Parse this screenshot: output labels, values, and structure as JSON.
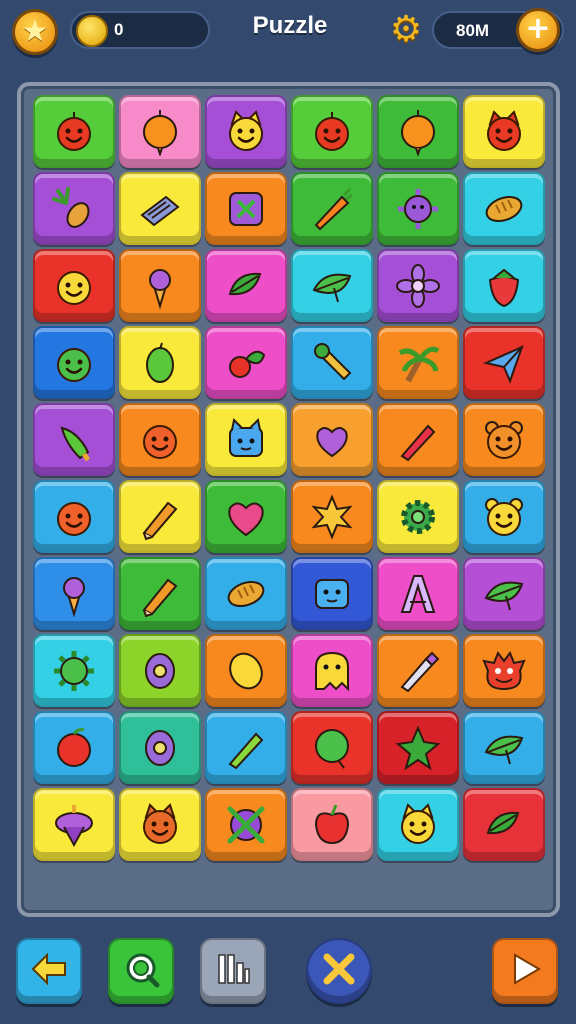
{
  "header": {
    "title": "Puzzle",
    "coins": "0",
    "cash": "80M"
  },
  "board": {
    "rows": [
      [
        {
          "color": "#55cc3a",
          "icon": "red-fruit-face-icon"
        },
        {
          "color": "#f78ac8",
          "icon": "orange-fruit-icon"
        },
        {
          "color": "#a44fd6",
          "icon": "yellow-cat-face-icon"
        },
        {
          "color": "#55cc3a",
          "icon": "red-fruit-face-icon"
        },
        {
          "color": "#3fbb3a",
          "icon": "orange-fruit-icon"
        },
        {
          "color": "#f9e93a",
          "icon": "red-devil-face-icon"
        }
      ],
      [
        {
          "color": "#a44fd6",
          "icon": "pineapple-icon"
        },
        {
          "color": "#f9e93a",
          "icon": "book-icon"
        },
        {
          "color": "#f7891f",
          "icon": "purple-box-icon"
        },
        {
          "color": "#3fbb3a",
          "icon": "carrot-icon"
        },
        {
          "color": "#3fbb3a",
          "icon": "purple-virus-icon"
        },
        {
          "color": "#33d0e6",
          "icon": "bread-icon"
        }
      ],
      [
        {
          "color": "#e8322a",
          "icon": "yellow-smiley-icon"
        },
        {
          "color": "#f7891f",
          "icon": "ice-cream-icon"
        },
        {
          "color": "#ee4fc9",
          "icon": "green-leaves-icon"
        },
        {
          "color": "#33d0e6",
          "icon": "green-leaf-icon"
        },
        {
          "color": "#a44fd6",
          "icon": "purple-flower-icon"
        },
        {
          "color": "#33d0e6",
          "icon": "strawberry-icon"
        }
      ],
      [
        {
          "color": "#2477e0",
          "icon": "green-blob-face-icon"
        },
        {
          "color": "#f9e93a",
          "icon": "green-mango-icon"
        },
        {
          "color": "#ee4fc9",
          "icon": "cherry-leaf-icon"
        },
        {
          "color": "#33aee8",
          "icon": "wrench-icon"
        },
        {
          "color": "#f7891f",
          "icon": "palm-tree-icon"
        },
        {
          "color": "#e8322a",
          "icon": "paper-plane-icon"
        }
      ],
      [
        {
          "color": "#a44fd6",
          "icon": "green-pepper-icon"
        },
        {
          "color": "#f7891f",
          "icon": "orange-face-icon"
        },
        {
          "color": "#f9e93a",
          "icon": "blue-cat-face-icon"
        },
        {
          "color": "#f7a030",
          "icon": "purple-heart-icon"
        },
        {
          "color": "#f7891f",
          "icon": "red-pen-icon"
        },
        {
          "color": "#f7891f",
          "icon": "orange-bear-face-icon"
        }
      ],
      [
        {
          "color": "#33aee8",
          "icon": "orange-face-icon"
        },
        {
          "color": "#f9e93a",
          "icon": "pencil-icon"
        },
        {
          "color": "#3fbb3a",
          "icon": "pink-heart-icon"
        },
        {
          "color": "#f7891f",
          "icon": "yellow-sun-icon"
        },
        {
          "color": "#f9e93a",
          "icon": "green-gear-icon"
        },
        {
          "color": "#33aee8",
          "icon": "yellow-bear-face-icon"
        }
      ],
      [
        {
          "color": "#2f8ee8",
          "icon": "ice-cream-icon"
        },
        {
          "color": "#3fbb3a",
          "icon": "pencil-icon"
        },
        {
          "color": "#33aee8",
          "icon": "bread-icon"
        },
        {
          "color": "#3358d6",
          "icon": "blue-block-face-icon"
        },
        {
          "color": "#ee4fc9",
          "icon": "letter-a-icon"
        },
        {
          "color": "#b44fd6",
          "icon": "green-leaf-icon"
        }
      ],
      [
        {
          "color": "#33d0e6",
          "icon": "green-virus-icon"
        },
        {
          "color": "#8cd32a",
          "icon": "purple-egg-icon"
        },
        {
          "color": "#f7891f",
          "icon": "lemon-icon"
        },
        {
          "color": "#ee4fc9",
          "icon": "yellow-ghost-icon"
        },
        {
          "color": "#f7891f",
          "icon": "paint-marker-icon"
        },
        {
          "color": "#f7891f",
          "icon": "red-monster-face-icon"
        }
      ],
      [
        {
          "color": "#33aee8",
          "icon": "apple-icon"
        },
        {
          "color": "#2fc09a",
          "icon": "purple-egg-icon"
        },
        {
          "color": "#33aee8",
          "icon": "green-pen-icon"
        },
        {
          "color": "#e8322a",
          "icon": "green-ball-icon"
        },
        {
          "color": "#d8222a",
          "icon": "green-star-fruit-icon"
        },
        {
          "color": "#33aee8",
          "icon": "green-leaf-icon"
        }
      ],
      [
        {
          "color": "#f9e93a",
          "icon": "spinning-top-icon"
        },
        {
          "color": "#f9e93a",
          "icon": "orange-cat-face-icon"
        },
        {
          "color": "#f7891f",
          "icon": "crossed-sticks-icon"
        },
        {
          "color": "#f99aa2",
          "icon": "red-apple-icon"
        },
        {
          "color": "#33d0e6",
          "icon": "yellow-cat-face-icon"
        },
        {
          "color": "#e8323a",
          "icon": "green-leaves-icon"
        }
      ]
    ]
  },
  "bottom_bar": {
    "buttons": [
      {
        "name": "back-button",
        "icon": "arrow-left-icon",
        "color": "#33b4e8"
      },
      {
        "name": "hint-button",
        "icon": "magnifier-icon",
        "color": "#39c43a"
      },
      {
        "name": "stats-button",
        "icon": "bars-icon",
        "color": "#9aa5b8"
      },
      {
        "name": "shuffle-button",
        "icon": "cross-icon",
        "color": "#3b57b8"
      },
      {
        "name": "play-button",
        "icon": "play-icon",
        "color": "#f37a1f"
      }
    ]
  }
}
